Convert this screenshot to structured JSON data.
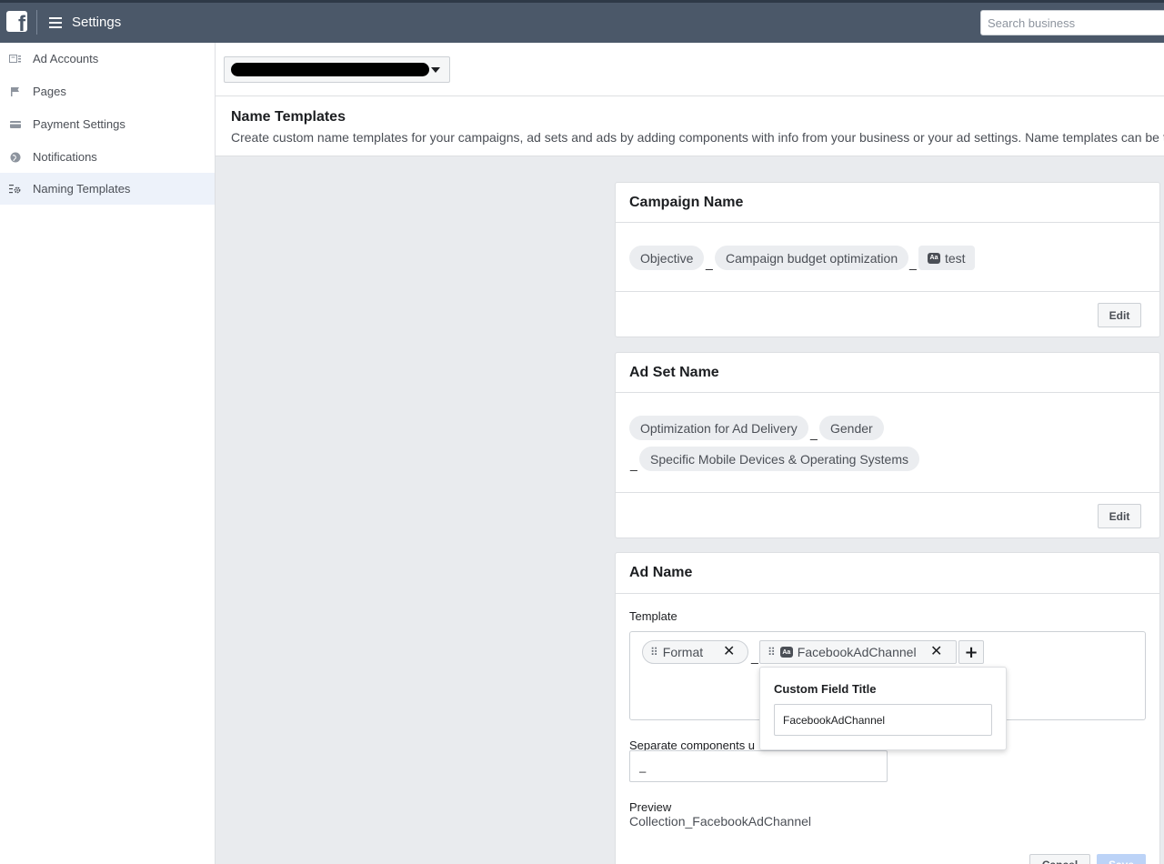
{
  "topbar": {
    "logo_letter": "f",
    "title": "Settings",
    "search_placeholder": "Search business"
  },
  "sidebar": {
    "items": [
      {
        "label": "Ad Accounts",
        "icon": "ad-accounts-icon"
      },
      {
        "label": "Pages",
        "icon": "flag-icon"
      },
      {
        "label": "Payment Settings",
        "icon": "credit-card-icon"
      },
      {
        "label": "Notifications",
        "icon": "globe-icon"
      },
      {
        "label": "Naming Templates",
        "icon": "naming-templates-icon",
        "active": true
      }
    ]
  },
  "account_selector": {
    "value": "[redacted]"
  },
  "name_templates": {
    "title": "Name Templates",
    "description": "Create custom name templates for your campaigns, ad sets and ads by adding components with info from your business or your ad settings. Name templates can be t"
  },
  "campaign_name": {
    "title": "Campaign Name",
    "components": [
      "Objective",
      "Campaign budget optimization",
      "test"
    ],
    "separator": "_",
    "edit_label": "Edit"
  },
  "ad_set_name": {
    "title": "Ad Set Name",
    "components": [
      "Optimization for Ad Delivery",
      "Gender",
      "Specific Mobile Devices & Operating Systems"
    ],
    "separator": "_",
    "edit_label": "Edit"
  },
  "ad_name": {
    "title": "Ad Name",
    "template_label": "Template",
    "components": [
      "Format",
      "FacebookAdChannel"
    ],
    "separator": "_",
    "badge_text": "Aa",
    "remove_glyph": "✕",
    "add_glyph": "+",
    "custom_field": {
      "title": "Custom Field Title",
      "value": "FacebookAdChannel"
    },
    "separate_label": "Separate components u",
    "separate_value": "_",
    "preview_label": "Preview",
    "preview_value": "Collection_FacebookAdChannel",
    "cancel_label": "Cancel",
    "save_label": "Save"
  },
  "colors": {
    "topbar": "#4b5869",
    "sidebar_active": "#edf2fa",
    "page_bg": "#e9ebee",
    "save_button": "#bcd3f7"
  }
}
